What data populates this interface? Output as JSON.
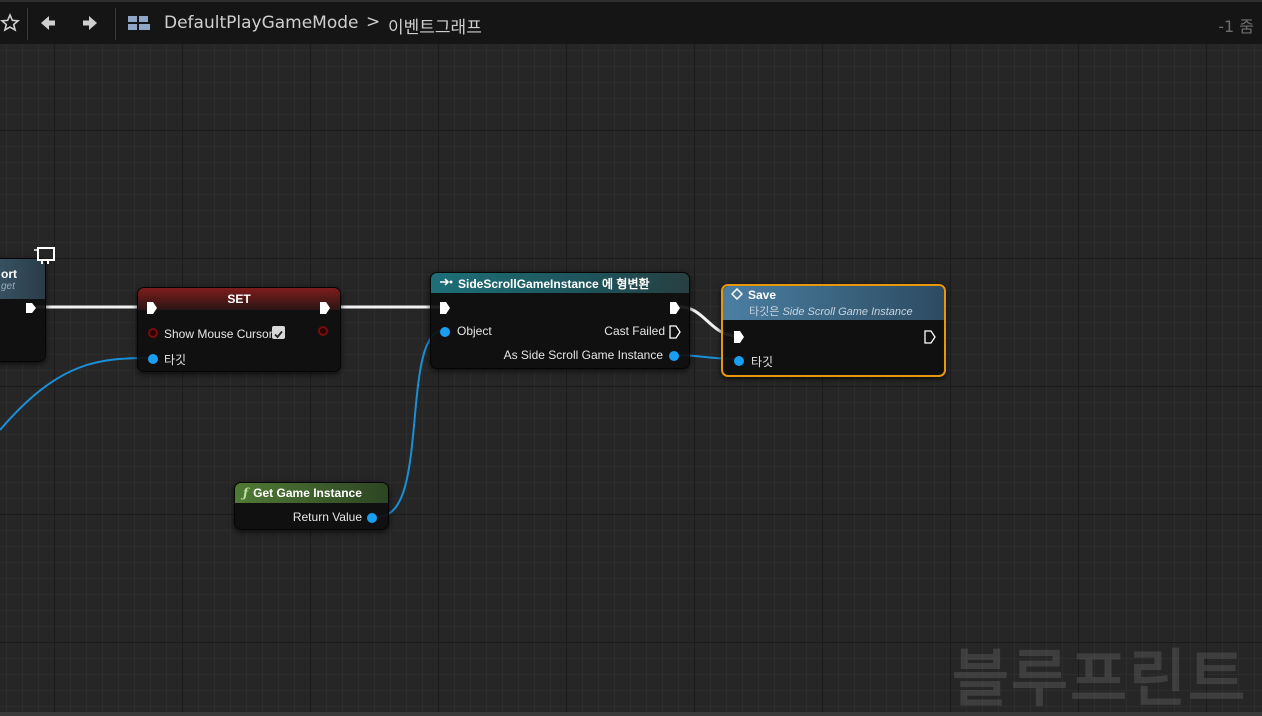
{
  "toolbar": {
    "breadcrumb_asset": "DefaultPlayGameMode",
    "breadcrumb_separator": ">",
    "breadcrumb_graph": "이벤트그래프",
    "zoom_label": "-1 줌"
  },
  "nodes": {
    "left_partial": {
      "title": "ort",
      "subtitle": "get"
    },
    "set": {
      "title": "SET",
      "show_mouse_cursor_label": "Show Mouse Cursor",
      "target_label": "타깃"
    },
    "cast": {
      "title": "SideScrollGameInstance 에 형변환",
      "object_label": "Object",
      "cast_failed_label": "Cast Failed",
      "as_label": "As Side Scroll Game Instance"
    },
    "get_game_instance": {
      "title": "Get Game Instance",
      "return_label": "Return Value"
    },
    "save": {
      "title": "Save",
      "subtitle_prefix": "타깃은",
      "subtitle_value": "Side Scroll Game Instance",
      "target_label": "타깃"
    }
  },
  "watermark": "블루프린트",
  "colors": {
    "object_pin": "#1a9ff0",
    "selection": "#e8960c",
    "cast_header": "#1e6f78",
    "set_header": "#7e1c1c",
    "pure_function_header": "#4f7a35",
    "function_header": "#4b7fa2"
  },
  "icons": [
    "star-icon",
    "back-arrow-icon",
    "forward-arrow-icon",
    "blueprint-graph-icon",
    "monitor-icon",
    "cast-icon",
    "function-icon",
    "diamond-icon",
    "checkbox-checked-icon"
  ]
}
